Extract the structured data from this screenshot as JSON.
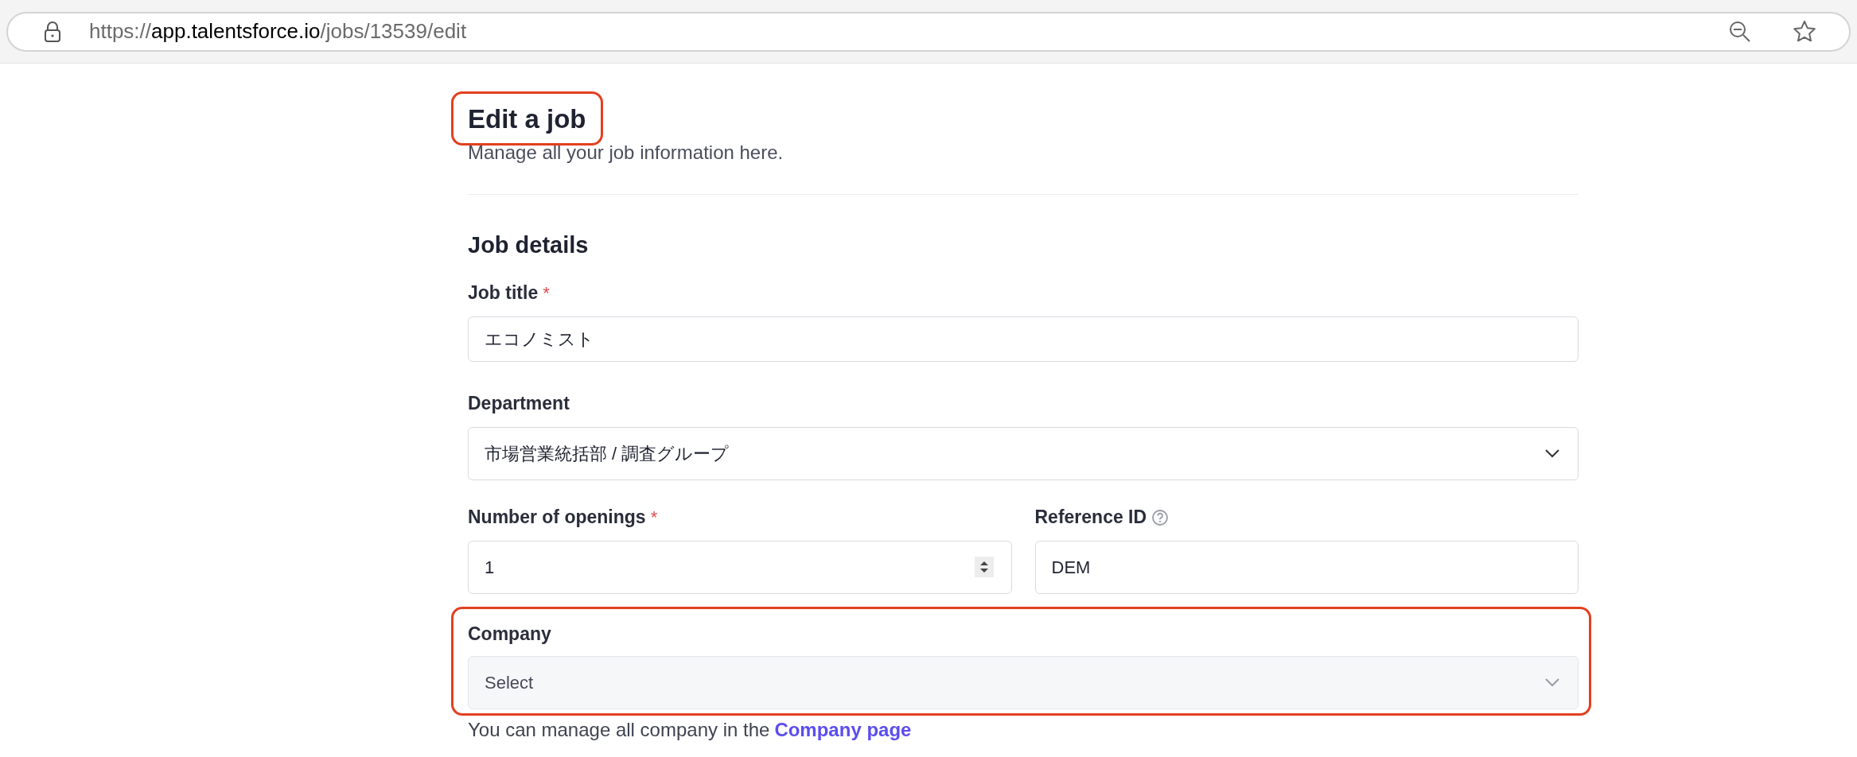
{
  "browser": {
    "url_scheme": "https://",
    "url_host": "app.talentsforce.io",
    "url_path": "/jobs/13539/edit"
  },
  "header": {
    "title": "Edit a job",
    "title_highlighted": true,
    "subtitle": "Manage all your job information here."
  },
  "section": {
    "title": "Job details"
  },
  "fields": [
    {
      "kind": "text",
      "label": "Job title",
      "required_mark": "*",
      "value": "エコノミスト"
    },
    {
      "kind": "select",
      "label": "Department",
      "value": "市場営業統括部 / 調査グループ"
    }
  ],
  "pair": [
    {
      "kind": "number",
      "label": "Number of openings",
      "required_mark": "*",
      "help": false,
      "value": "1"
    },
    {
      "kind": "text",
      "label": "Reference ID",
      "help": true,
      "value": "DEM"
    }
  ],
  "company": {
    "label": "Company",
    "placeholder": "Select",
    "highlighted": true,
    "hint": "You can manage all company in the",
    "link": "Company page"
  }
}
